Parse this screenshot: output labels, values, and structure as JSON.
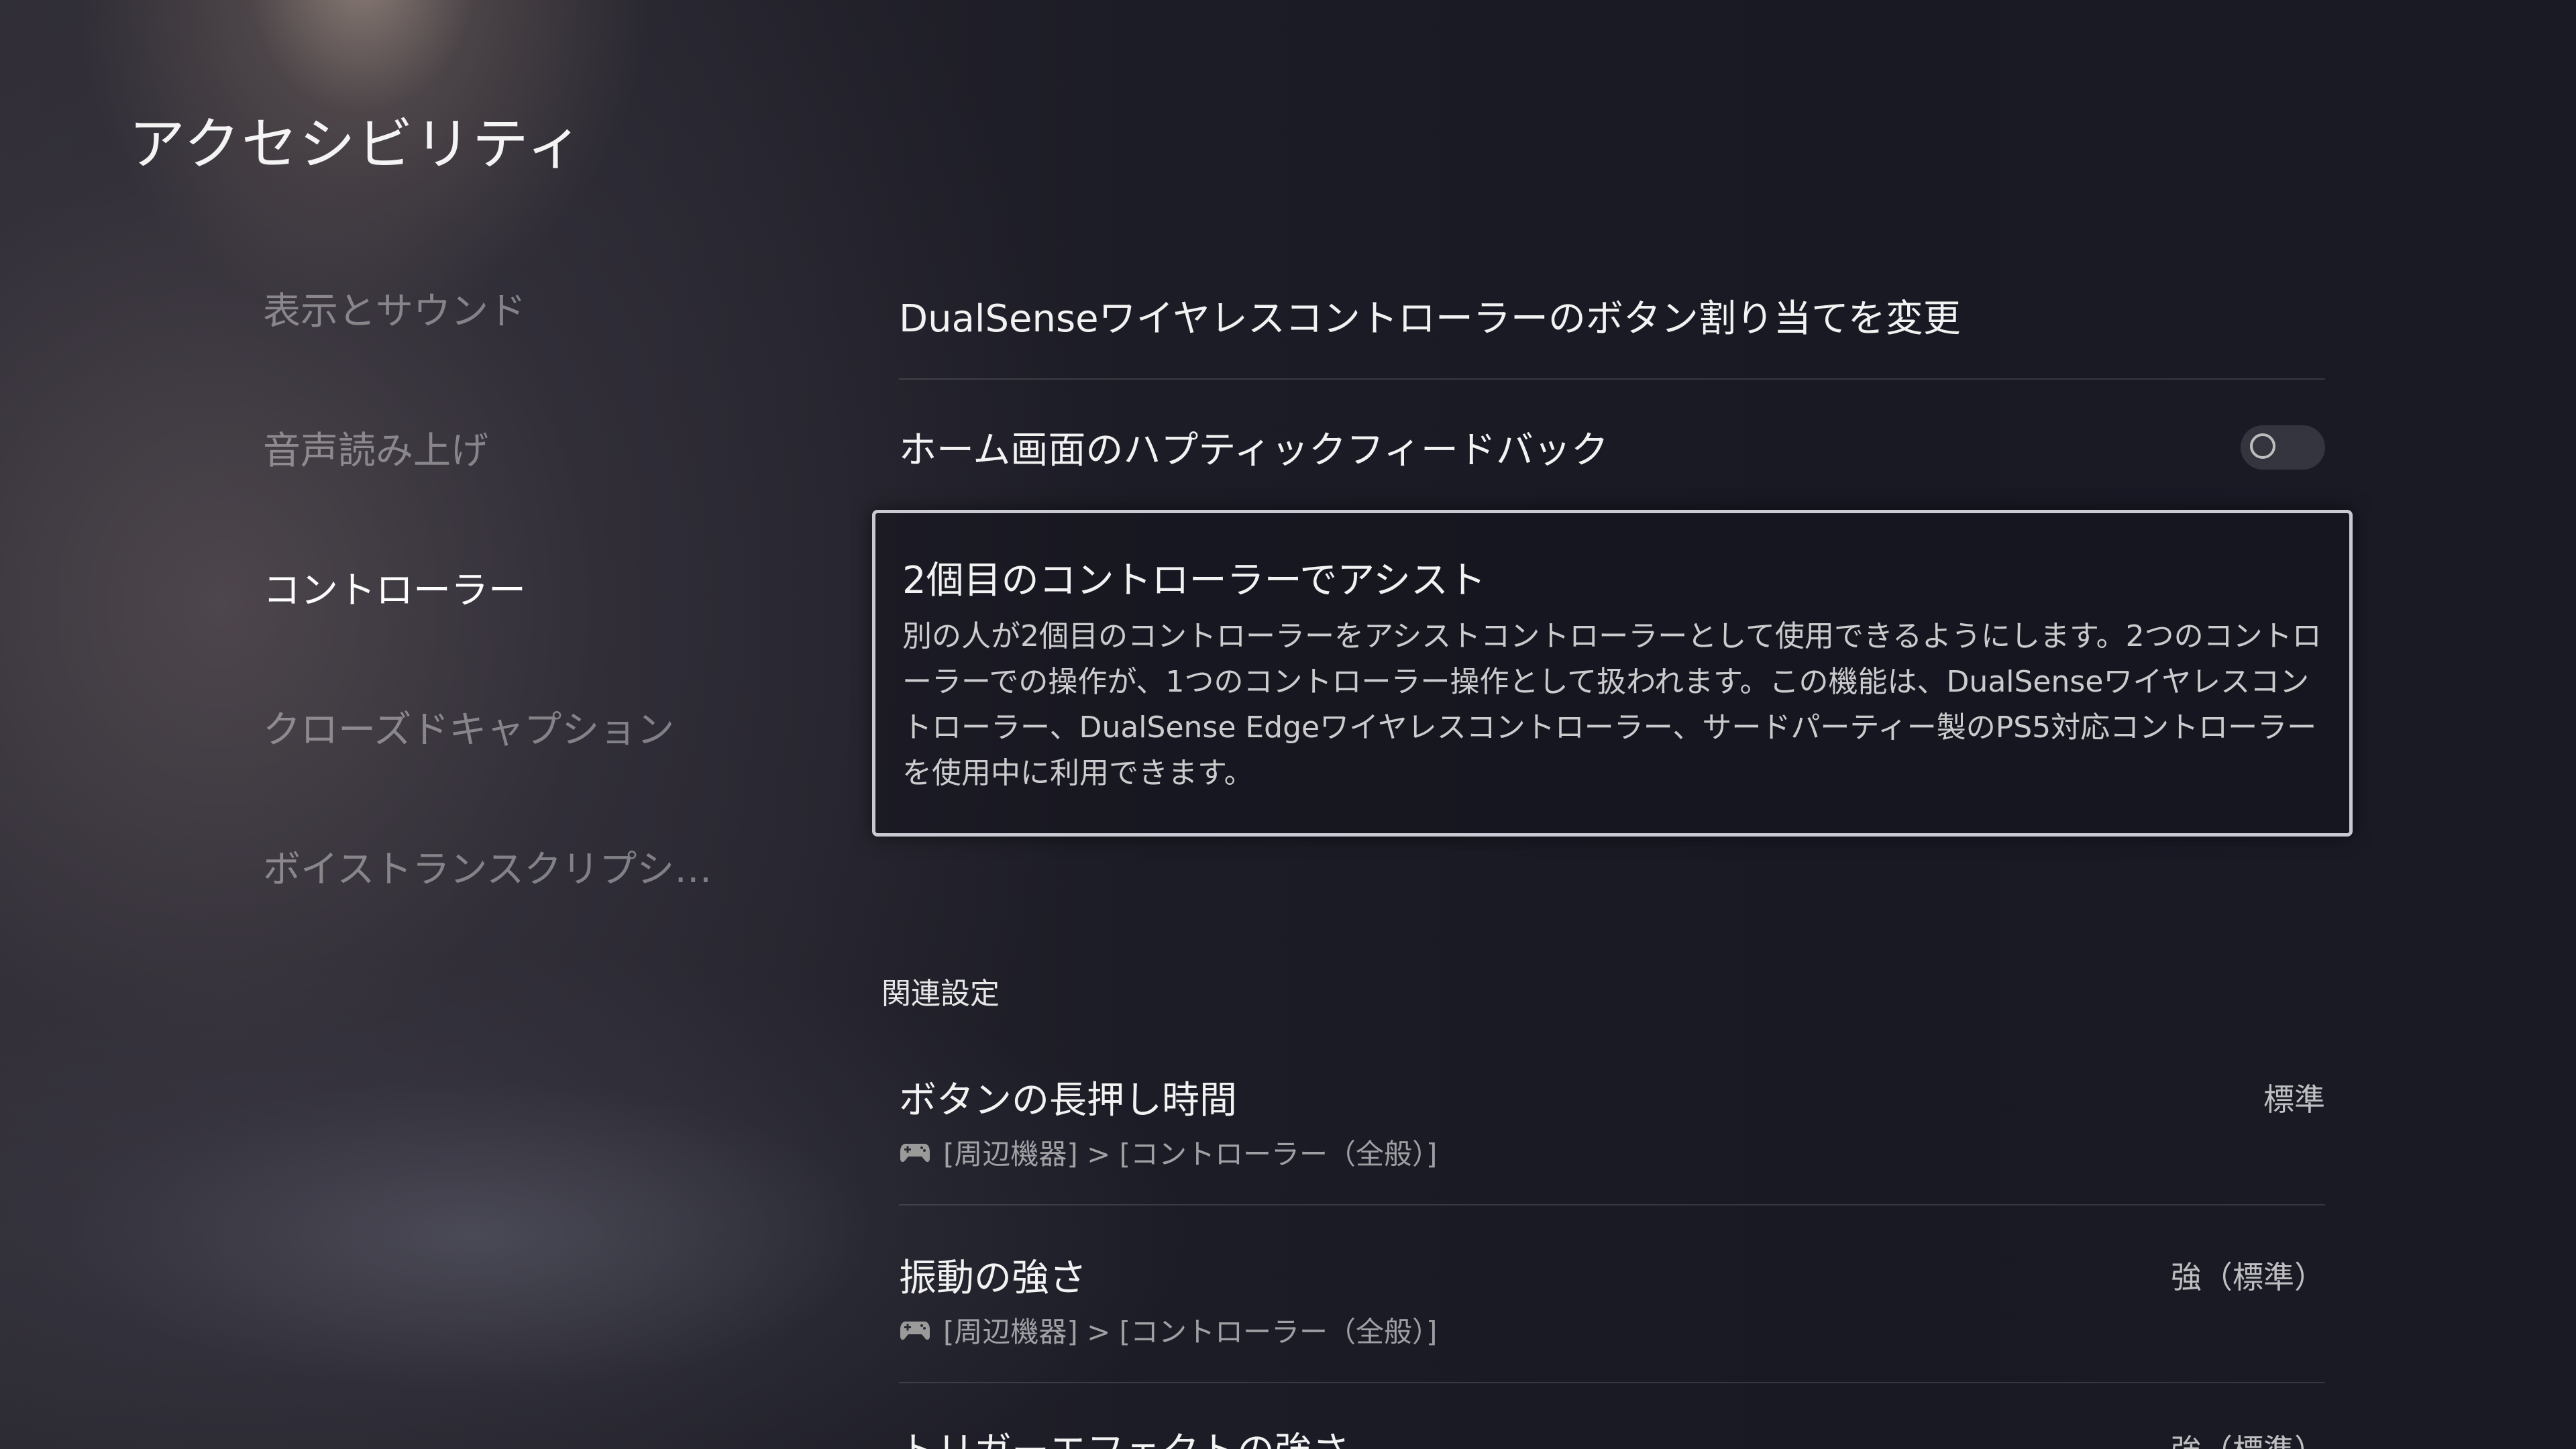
{
  "page": {
    "title": "アクセシビリティ"
  },
  "sidebar": {
    "items": [
      {
        "label": "表示とサウンド",
        "active": false
      },
      {
        "label": "音声読み上げ",
        "active": false
      },
      {
        "label": "コントローラー",
        "active": true
      },
      {
        "label": "クローズドキャプション",
        "active": false
      },
      {
        "label": "ボイストランスクリプシ…",
        "active": false
      }
    ]
  },
  "main": {
    "button_assign": {
      "title": "DualSenseワイヤレスコントローラーのボタン割り当てを変更"
    },
    "haptic": {
      "title": "ホーム画面のハプティックフィードバック",
      "toggle_state": "off"
    },
    "assist": {
      "title": "2個目のコントローラーでアシスト",
      "description": "別の人が2個目のコントローラーをアシストコントローラーとして使用できるようにします。2つのコントローラーでの操作が、1つのコントローラー操作として扱われます。この機能は、DualSenseワイヤレスコントローラー、DualSense Edgeワイヤレスコントローラー、サードパーティー製のPS5対応コントローラーを使用中に利用できます。"
    },
    "related": {
      "label": "関連設定",
      "items": [
        {
          "title": "ボタンの長押し時間",
          "value": "標準",
          "path": "[周辺機器] > [コントローラー（全般）]"
        },
        {
          "title": "振動の強さ",
          "value": "強（標準）",
          "path": "[周辺機器] > [コントローラー（全般）]"
        },
        {
          "title": "トリガーエフェクトの強さ",
          "value": "強（標準）"
        }
      ]
    }
  },
  "icons": {
    "controller": "controller-icon"
  }
}
